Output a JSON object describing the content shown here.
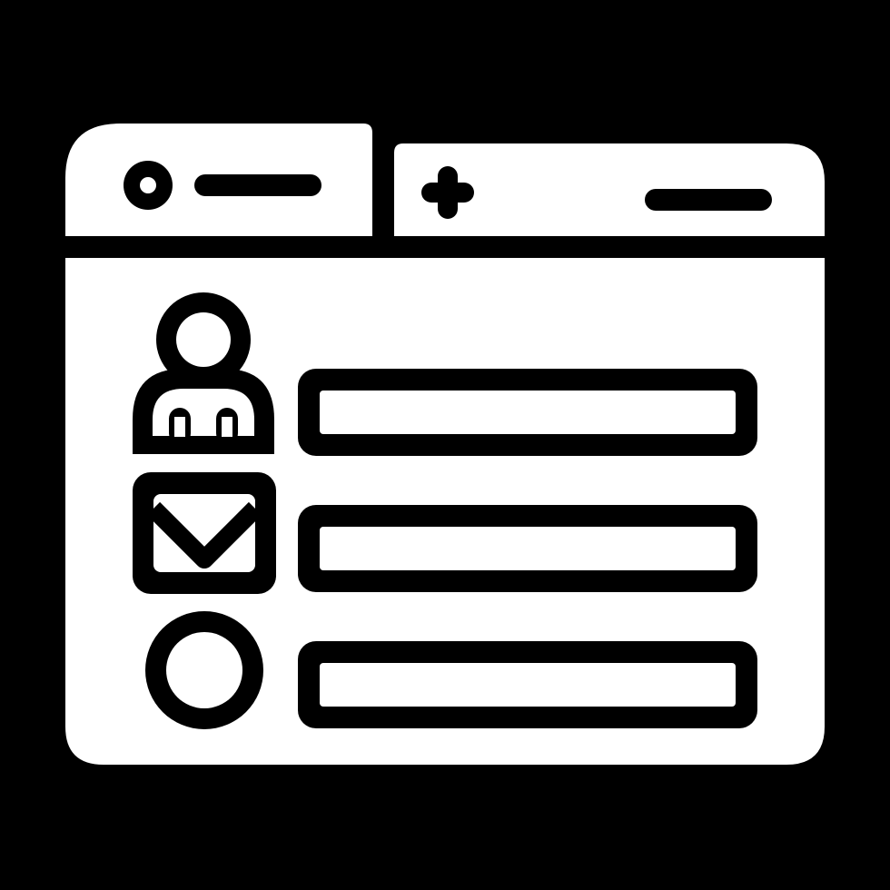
{
  "colors": {
    "background": "#000000",
    "foreground": "#ffffff"
  },
  "browser_window": {
    "tabs": [
      {
        "id": "active-tab",
        "icons": [
          "circle-icon",
          "dash-icon"
        ]
      },
      {
        "id": "new-tab",
        "icons": [
          "plus-icon",
          "dash-icon"
        ]
      }
    ],
    "form_rows": [
      {
        "icon": "user-icon",
        "field": "text-input-field"
      },
      {
        "icon": "email-icon",
        "field": "text-input-field"
      },
      {
        "icon": "circle-icon",
        "field": "text-input-field"
      }
    ]
  }
}
